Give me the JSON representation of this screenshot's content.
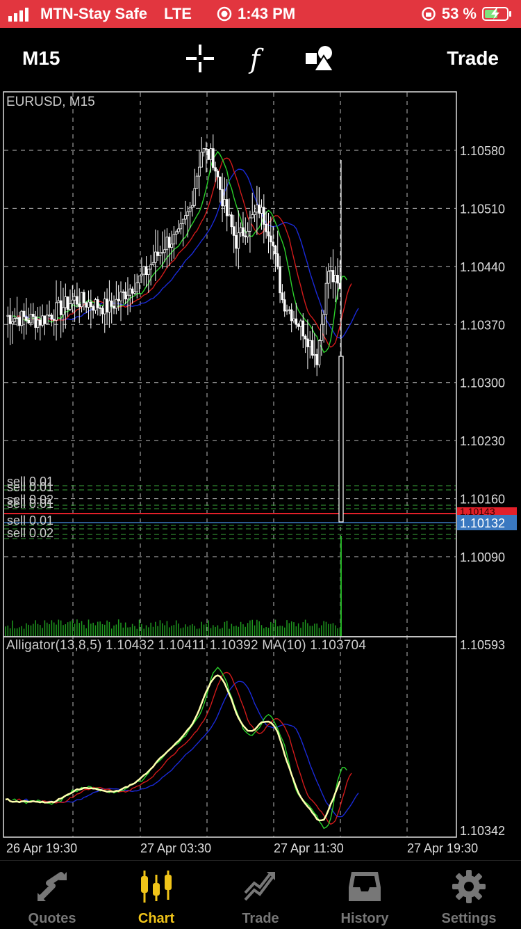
{
  "status": {
    "carrier": "MTN-Stay Safe",
    "network": "LTE",
    "time": "1:43 PM",
    "battery": "53 %"
  },
  "toolbar": {
    "timeframe": "M15",
    "trade_label": "Trade"
  },
  "chart": {
    "symbol_label": "EURUSD, M15",
    "indicator_label": "Alligator(13,8,5) 1.10432 1.10411 1.10392 MA(10) 1.103704",
    "price_ticks": [
      "1.10580",
      "1.10510",
      "1.10440",
      "1.10370",
      "1.10300",
      "1.10230",
      "1.10160",
      "1.10090"
    ],
    "current_price": "1.10132",
    "red_price": "1.10143",
    "sub_ticks": [
      "1.10593",
      "1.10342"
    ],
    "time_ticks": [
      "26 Apr 19:30",
      "27 Apr 03:30",
      "27 Apr 11:30",
      "27 Apr 19:30"
    ],
    "order_labels": [
      "sell 0.01",
      "sell 0.01",
      "sell 0.02",
      "sell 0.01",
      "sell 0.01",
      "sell 0.02"
    ],
    "colors": {
      "jaw": "#1a2ad8",
      "teeth": "#d11a1a",
      "lips": "#2ad12a",
      "ma": "#ffffb0",
      "ask": "#e2202a",
      "bid": "#3a78c0"
    }
  },
  "chart_data": {
    "type": "candlestick",
    "series": [
      {
        "name": "Alligator(13,8,5)",
        "values": [
          1.10432,
          1.10411,
          1.10392
        ]
      },
      {
        "name": "MA(10)",
        "values": [
          1.103704
        ]
      }
    ],
    "ylim": [
      1.1004,
      1.1065
    ]
  },
  "tabs": [
    {
      "label": "Quotes"
    },
    {
      "label": "Chart"
    },
    {
      "label": "Trade"
    },
    {
      "label": "History"
    },
    {
      "label": "Settings"
    }
  ]
}
